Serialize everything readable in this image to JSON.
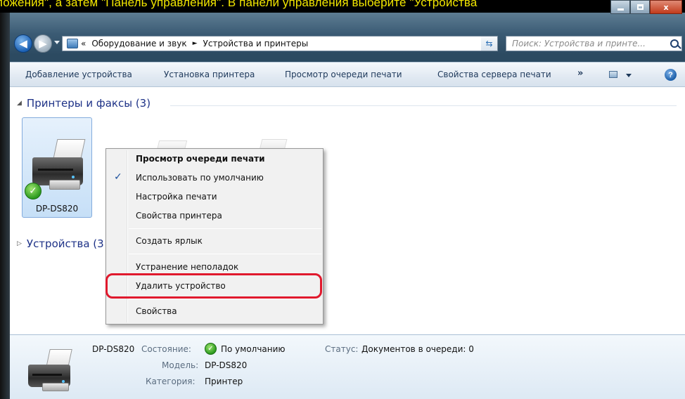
{
  "caption": {
    "text": "ложения\", а затем \"Панель управления\". В панели управления выберите \"Устройства"
  },
  "window": {
    "buttons": {
      "minimize": "minimize",
      "maximize": "maximize",
      "close": "x"
    }
  },
  "address_bar": {
    "overflow": "«",
    "crumb1": "Оборудование и звук",
    "separator": "►",
    "crumb2": "Устройства и принтеры",
    "dropdown": "▼"
  },
  "search": {
    "placeholder": "Поиск: Устройства и принте..."
  },
  "commands": {
    "add_device": "Добавление устройства",
    "install_printer": "Установка принтера",
    "view_queue": "Просмотр очереди печати",
    "server_props": "Свойства сервера печати",
    "more": "»",
    "help": "?"
  },
  "groups": {
    "printers": {
      "toggle": "◢",
      "title": "Принтеры и факсы (3)"
    },
    "devices": {
      "toggle": "▷",
      "title": "Устройства (3"
    }
  },
  "selected_device": {
    "name": "DP-DS820"
  },
  "context_menu": {
    "checked_mark": "✓",
    "items": [
      "Просмотр очереди печати",
      "Использовать по умолчанию",
      "Настройка печати",
      "Свойства принтера",
      "Создать ярлык",
      "Устранение неполадок",
      "Удалить устройство",
      "Свойства"
    ],
    "highlighted_item": "Удалить устройство"
  },
  "details_pane": {
    "name": "DP-DS820",
    "state_label": "Состояние:",
    "state_value": "По умолчанию",
    "status_label": "Статус:",
    "status_value": "Документов в очереди: 0",
    "model_label": "Модель:",
    "model_value": "DP-DS820",
    "category_label": "Категория:",
    "category_value": "Принтер"
  },
  "colors": {
    "caption_text": "#f2e600",
    "highlight_ring": "#e0192d",
    "group_title": "#1e3287",
    "command_text": "#1e395b"
  }
}
